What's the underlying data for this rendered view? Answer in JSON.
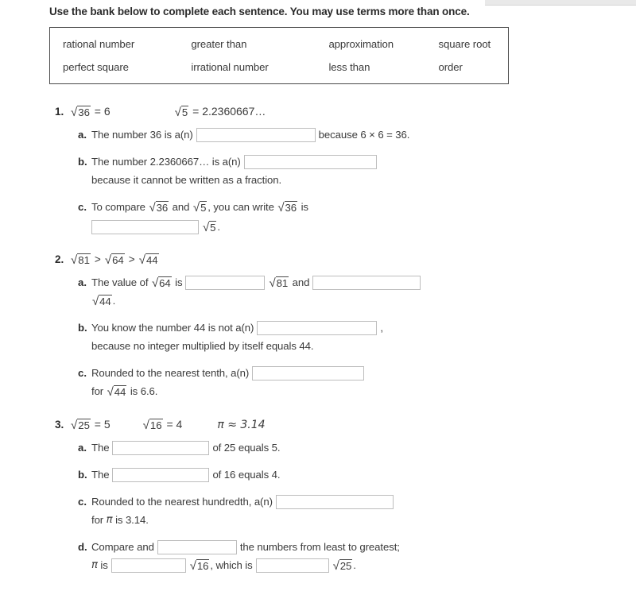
{
  "instructions": "Use the bank below to complete each sentence. You may use terms more than once.",
  "word_bank": {
    "row1": [
      "rational number",
      "greater than",
      "approximation",
      "square root"
    ],
    "row2": [
      "perfect square",
      "irrational number",
      "less than",
      "order"
    ]
  },
  "questions": [
    {
      "number": "1.",
      "expressions": [
        "√36 = 6",
        "√5 = 2.2360667…"
      ],
      "expr_parts": {
        "e1_radicand": "36",
        "e1_tail": " = 6",
        "e2_radicand": "5",
        "e2_tail": " = 2.2360667…"
      },
      "parts": [
        {
          "letter": "a.",
          "lines": [
            {
              "before": "The number 36 is a(n)",
              "blank_width": 150,
              "after": "because 6 × 6 = 36."
            }
          ]
        },
        {
          "letter": "b.",
          "lines": [
            {
              "before": "The number 2.2360667… is a(n)",
              "blank_width": 167,
              "after": ""
            },
            {
              "before": "because it cannot be written as a fraction.",
              "blank_width": 0,
              "after": ""
            }
          ]
        },
        {
          "letter": "c.",
          "line1_pre": "To compare ",
          "line1_rad1": "36",
          "line1_mid": " and ",
          "line1_rad2": "5",
          "line1_post": ", you can write ",
          "line1_rad3": "36",
          "line1_end": " is",
          "line2_blank_width": 135,
          "line2_rad": "5",
          "line2_end": "."
        }
      ]
    },
    {
      "number": "2.",
      "expr_parts": {
        "r1": "81",
        "op1": ">",
        "r2": "64",
        "op2": ">",
        "r3": "44"
      },
      "parts": [
        {
          "letter": "a.",
          "pre": "The value of ",
          "rad1": "64",
          "mid1": " is",
          "blank1_width": 100,
          "rad2": "81",
          "mid2": " and",
          "blank2_width": 136,
          "line2_rad": "44",
          "line2_end": "."
        },
        {
          "letter": "b.",
          "lines": [
            {
              "before": "You know the number 44 is not a(n)",
              "blank_width": 151,
              "after": ","
            },
            {
              "before": "because no integer multiplied by itself equals 44.",
              "blank_width": 0,
              "after": ""
            }
          ]
        },
        {
          "letter": "c.",
          "line1_before": "Rounded to the nearest tenth, a(n)",
          "line1_blank_width": 141,
          "line2_pre": "for ",
          "line2_rad": "44",
          "line2_post": " is 6.6."
        }
      ]
    },
    {
      "number": "3.",
      "expr_parts": {
        "e1_radicand": "25",
        "e1_tail": " = 5",
        "e2_radicand": "16",
        "e2_tail": " = 4",
        "e3": "π ≈ 3.14"
      },
      "parts": [
        {
          "letter": "a.",
          "lines": [
            {
              "before": "The",
              "blank_width": 122,
              "after": "of 25 equals 5."
            }
          ]
        },
        {
          "letter": "b.",
          "lines": [
            {
              "before": "The",
              "blank_width": 122,
              "after": "of 16 equals 4."
            }
          ]
        },
        {
          "letter": "c.",
          "line1_before": "Rounded to the nearest hundredth, a(n)",
          "line1_blank_width": 148,
          "line2_pre": "for ",
          "line2_pi": "π",
          "line2_post": " is 3.14."
        },
        {
          "letter": "d.",
          "line1_before": "Compare and",
          "line1_blank_width": 100,
          "line1_after": "the numbers from least to greatest;",
          "line2_pi": "π",
          "line2_is": " is",
          "line2_blank1_width": 94,
          "line2_rad1": "16",
          "line2_mid": ", which is",
          "line2_blank2_width": 92,
          "line2_rad2": "25",
          "line2_end": "."
        }
      ]
    }
  ]
}
